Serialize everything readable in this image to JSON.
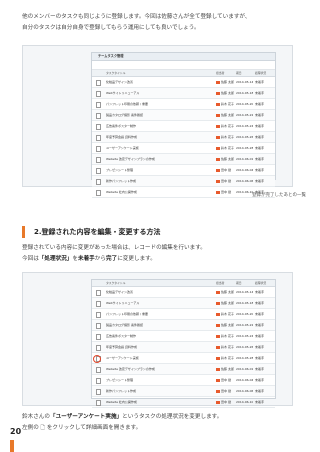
{
  "intro": {
    "line1": "他のメンバーのタスクも同じように登録します。今回は佐藤さんが全て登録していますが、",
    "line2": "自分のタスクは自分自身で登録してもらう運用にしても良いでしょう。"
  },
  "screen": {
    "title": "チームタスク管理",
    "headers": [
      "タスクタイトル",
      "担当者",
      "期日",
      "処理状況"
    ],
    "rows": [
      {
        "title": "化粧品デザイン改善",
        "assignee": "佐藤 太郎",
        "date": "2014-05-14",
        "status": "未着手"
      },
      {
        "title": "Webサイトリニューアル",
        "assignee": "佐藤 太郎",
        "date": "2014-05-18",
        "status": "未着手"
      },
      {
        "title": "パンフレット印刷の依頼 / 重要",
        "assignee": "鈴木 花子",
        "date": "2014-05-20",
        "status": "未着手"
      },
      {
        "title": "製品カタログ撮影 案件確認",
        "assignee": "佐藤 太郎",
        "date": "2014-05-22",
        "status": "未着手"
      },
      {
        "title": "広告案件ポスター制作",
        "assignee": "鈴木 花子",
        "date": "2014-05-24",
        "status": "未着手"
      },
      {
        "title": "年度予算会議 資料作成",
        "assignee": "鈴木 花子",
        "date": "2014-05-26",
        "status": "未着手"
      },
      {
        "title": "ユーザーアンケート実施",
        "assignee": "鈴木 花子",
        "date": "2014-05-28",
        "status": "未着手"
      },
      {
        "title": "Website 改定デザインプランの作成",
        "assignee": "佐藤 太郎",
        "date": "2014-06-01",
        "status": "未着手"
      },
      {
        "title": "プレゼンシート整理",
        "assignee": "田中 健",
        "date": "2014-06-04",
        "status": "未着手"
      },
      {
        "title": "新作パンフレット作成",
        "assignee": "田中 健",
        "date": "2014-06-06",
        "status": "未着手"
      },
      {
        "title": "Website 社内公開作成",
        "assignee": "田中 健",
        "date": "2014-06-10",
        "status": "未着手"
      }
    ]
  },
  "caption": "登録が完了したあとの一覧",
  "section": {
    "title": "2.登録された内容を編集・変更する方法",
    "line1": "登録されている内容に変更があった場合は、レコードの編集を行います。",
    "line2a": "今回は",
    "line2b": "「処理状況」",
    "line2c": "を",
    "line2d": "未着手",
    "line2e": "から",
    "line2f": "完了",
    "line2g": "に変更します。"
  },
  "outro": {
    "line1a": "鈴木さんの",
    "line1b": "「ユーザーアンケート実施」",
    "line1c": "というタスクの処理状況を変更します。",
    "line2": "左側の 🗋 をクリックして詳細画面を開きます。"
  },
  "page_number": "20"
}
